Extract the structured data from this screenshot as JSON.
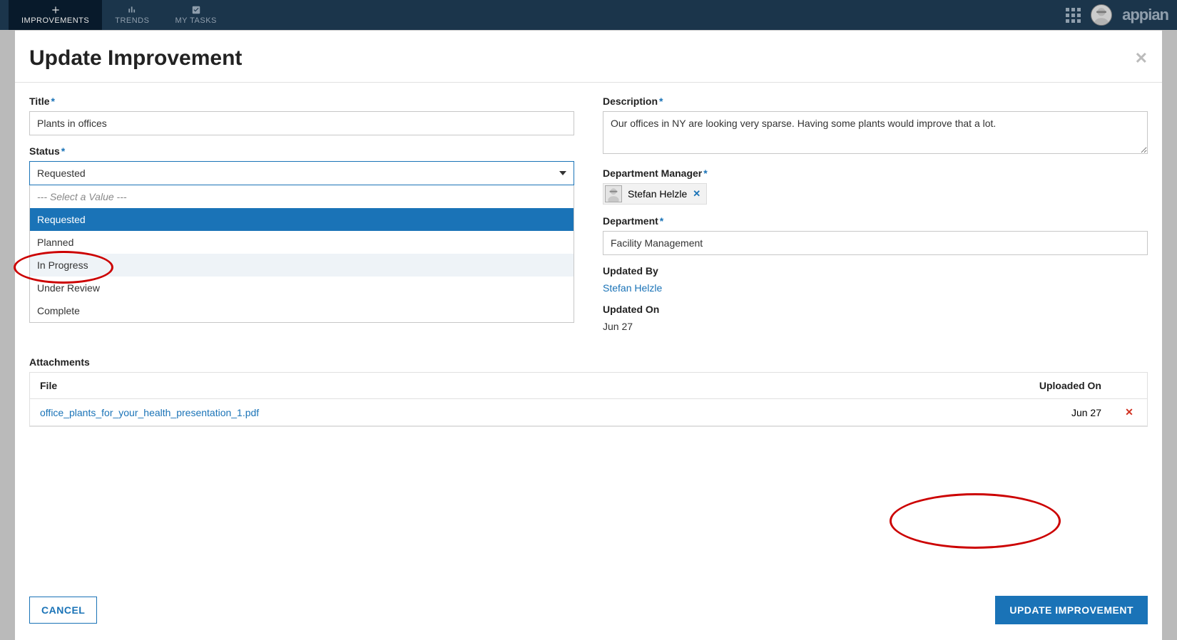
{
  "topbar": {
    "tabs": [
      {
        "label": "IMPROVEMENTS",
        "active": true,
        "icon": "plus"
      },
      {
        "label": "TRENDS",
        "active": false,
        "icon": "bar-chart"
      },
      {
        "label": "MY TASKS",
        "active": false,
        "icon": "check-square"
      }
    ],
    "logo": "appian"
  },
  "modal": {
    "title": "Update Improvement",
    "fields": {
      "title_label": "Title",
      "title_value": "Plants in offices",
      "status_label": "Status",
      "status_value": "Requested",
      "status_placeholder": "--- Select a Value ---",
      "status_options": [
        "Requested",
        "Planned",
        "In Progress",
        "Under Review",
        "Complete"
      ],
      "description_label": "Description",
      "description_value": "Our offices in NY are looking very sparse. Having some plants would improve that a lot.",
      "manager_label": "Department Manager",
      "manager_chip": "Stefan Helzle",
      "department_label": "Department",
      "department_value": "Facility Management",
      "updated_by_label": "Updated By",
      "updated_by_value": "Stefan Helzle",
      "updated_on_label": "Updated On",
      "updated_on_value": "Jun 27"
    },
    "attachments": {
      "label": "Attachments",
      "headers": {
        "file": "File",
        "uploaded": "Uploaded On"
      },
      "rows": [
        {
          "file": "office_plants_for_your_health_presentation_1.pdf",
          "uploaded": "Jun 27"
        }
      ]
    },
    "buttons": {
      "cancel": "CANCEL",
      "submit": "UPDATE IMPROVEMENT"
    }
  }
}
